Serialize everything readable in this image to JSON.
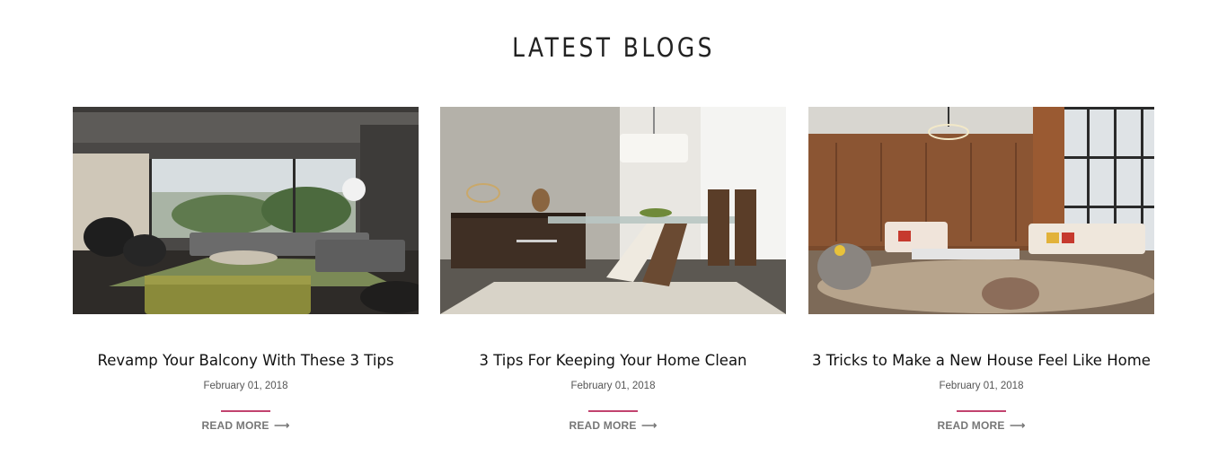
{
  "section": {
    "title": "LATEST BLOGS"
  },
  "colors": {
    "accent": "#c2436f",
    "read_more": "#777777"
  },
  "posts": [
    {
      "title": "Revamp Your Balcony With These 3 Tips",
      "date": "February 01, 2018",
      "read_more": "READ MORE",
      "arrow": "⟶",
      "image": "living-room-with-sectional-sofa"
    },
    {
      "title": "3 Tips For Keeping Your Home Clean",
      "date": "February 01, 2018",
      "read_more": "READ MORE",
      "arrow": "⟶",
      "image": "dining-room-with-glass-table"
    },
    {
      "title": "3 Tricks to Make a New House Feel Like Home",
      "date": "February 01, 2018",
      "read_more": "READ MORE",
      "arrow": "⟶",
      "image": "lounge-with-wood-paneling"
    }
  ]
}
